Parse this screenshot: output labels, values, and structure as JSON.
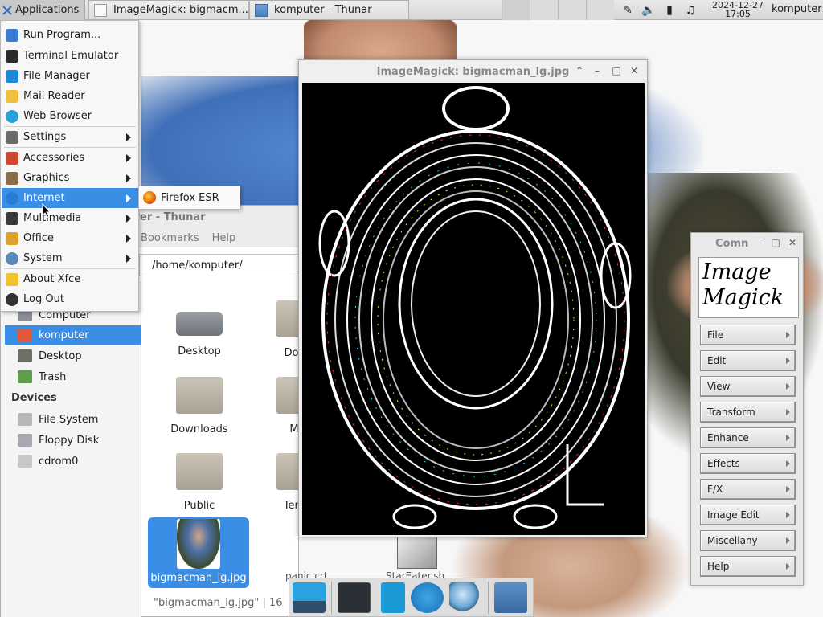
{
  "top_panel": {
    "applications_label": "Applications",
    "tasks": [
      {
        "label": "ImageMagick: bigmacm..."
      },
      {
        "label": "komputer - Thunar"
      }
    ],
    "clock_date": "2024-12-27",
    "clock_time": "17:05",
    "user": "komputer"
  },
  "app_menu": {
    "items": [
      {
        "label": "Run Program..."
      },
      {
        "label": "Terminal Emulator"
      },
      {
        "label": "File Manager"
      },
      {
        "label": "Mail Reader"
      },
      {
        "label": "Web Browser"
      },
      {
        "label": "Settings"
      },
      {
        "label": "Accessories"
      },
      {
        "label": "Graphics"
      },
      {
        "label": "Internet"
      },
      {
        "label": "Multimedia"
      },
      {
        "label": "Office"
      },
      {
        "label": "System"
      },
      {
        "label": "About Xfce"
      },
      {
        "label": "Log Out"
      }
    ],
    "submenu_item": "Firefox ESR"
  },
  "thunar": {
    "title": "komputer - Thunar",
    "menu_bookmarks": "Bookmarks",
    "menu_help": "Help",
    "path": "/home/komputer/",
    "places": [
      {
        "label": "Computer"
      },
      {
        "label": "komputer"
      },
      {
        "label": "Desktop"
      },
      {
        "label": "Trash"
      }
    ],
    "devices_heading": "Devices",
    "devices": [
      {
        "label": "File System"
      },
      {
        "label": "Floppy Disk"
      },
      {
        "label": "cdrom0"
      }
    ],
    "files": [
      {
        "label": "Desktop"
      },
      {
        "label": "Doc"
      },
      {
        "label": "Downloads"
      },
      {
        "label": "M"
      },
      {
        "label": "Public"
      },
      {
        "label": "Tem"
      },
      {
        "label": "bigmacman_lg.jpg"
      },
      {
        "label": "panic.crt"
      },
      {
        "label": "StarEater.sh"
      }
    ],
    "status": "\"bigmacman_lg.jpg\" | 16"
  },
  "imagemagick_window": {
    "title": "ImageMagick: bigmacman_lg.jpg"
  },
  "command_widget": {
    "title": "Comn",
    "logo_line1": "Image",
    "logo_line2": "Magick",
    "buttons": [
      {
        "label": "File"
      },
      {
        "label": "Edit"
      },
      {
        "label": "View"
      },
      {
        "label": "Transform"
      },
      {
        "label": "Enhance"
      },
      {
        "label": "Effects"
      },
      {
        "label": "F/X"
      },
      {
        "label": "Image Edit"
      },
      {
        "label": "Miscellany"
      },
      {
        "label": "Help"
      }
    ]
  },
  "colors": {
    "selection": "#3a8ee6",
    "panel": "#dcdcdc"
  }
}
